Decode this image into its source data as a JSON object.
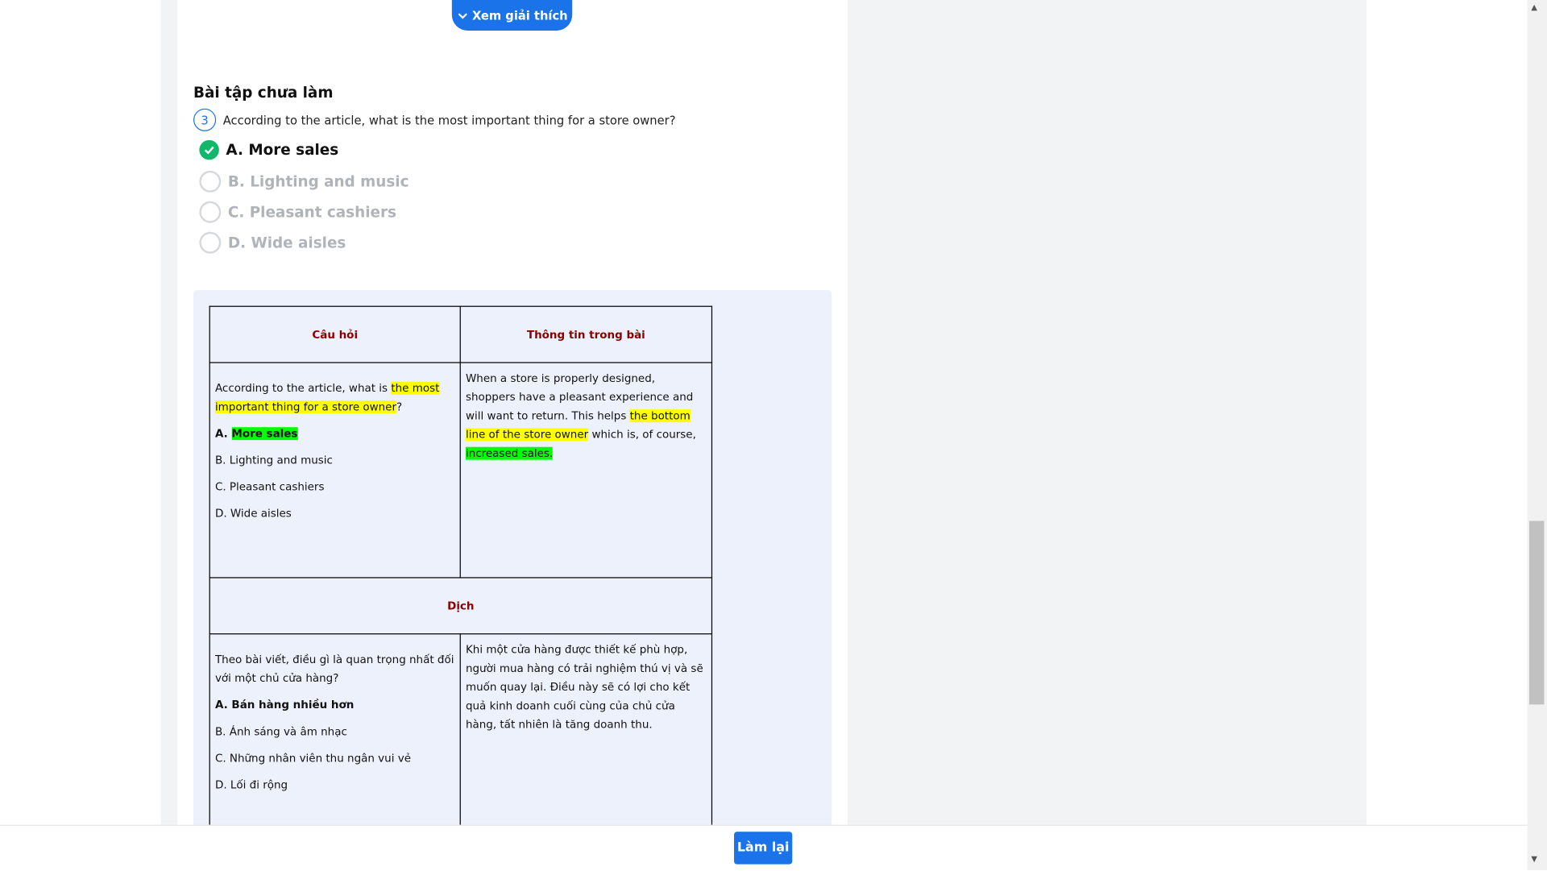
{
  "explain_button": {
    "label": "Xem giải thích"
  },
  "section_title": "Bài tập chưa làm",
  "question": {
    "number": "3",
    "text": "According to the article, what is the most important thing for a store owner?",
    "options": [
      {
        "label": "A. More sales",
        "selected": true
      },
      {
        "label": "B. Lighting and music",
        "selected": false
      },
      {
        "label": "C. Pleasant cashiers",
        "selected": false
      },
      {
        "label": "D. Wide aisles",
        "selected": false
      }
    ]
  },
  "table": {
    "header_question": "Câu hỏi",
    "header_info": "Thông tin trong bài",
    "q_pre": "According to the article, what is ",
    "q_hl": "the most important thing for a store owner",
    "q_post": "?",
    "ans_prefix": "A. ",
    "ans_hl": "More sales",
    "opt_b": "B. Lighting and music",
    "opt_c": "C. Pleasant cashiers",
    "opt_d": "D. Wide aisles",
    "info_pre": "When a store is properly designed, shoppers have a pleasant experience and will want to return. This helps ",
    "info_hl": "the bottom line of the store owner",
    "info_mid": " which is, of course, ",
    "info_green": "increased sales.",
    "translate_header": "Dịch",
    "vi_q": "Theo bài viết, điều gì là quan trọng nhất đối với một chủ cửa hàng?",
    "vi_a": "A. Bán hàng nhiều hơn",
    "vi_b": "B. Ánh sáng và âm nhạc",
    "vi_c": "C. Những nhân viên thu ngân vui vẻ",
    "vi_d": "D. Lối đi rộng",
    "vi_info": "Khi một cửa hàng được thiết kế phù hợp, người mua hàng có trải nghiệm thú vị và sẽ muốn quay lại. Điều này sẽ có lợi cho kết quả kinh doanh cuối cùng của chủ cửa hàng, tất nhiên là tăng doanh thu."
  },
  "redo_button": {
    "label": "Làm lại"
  },
  "colors": {
    "accent": "#1a73e8",
    "correct": "#12b76a",
    "highlight_yellow": "#ffff00",
    "highlight_green": "#00ff00",
    "header_red": "#8b0000"
  }
}
